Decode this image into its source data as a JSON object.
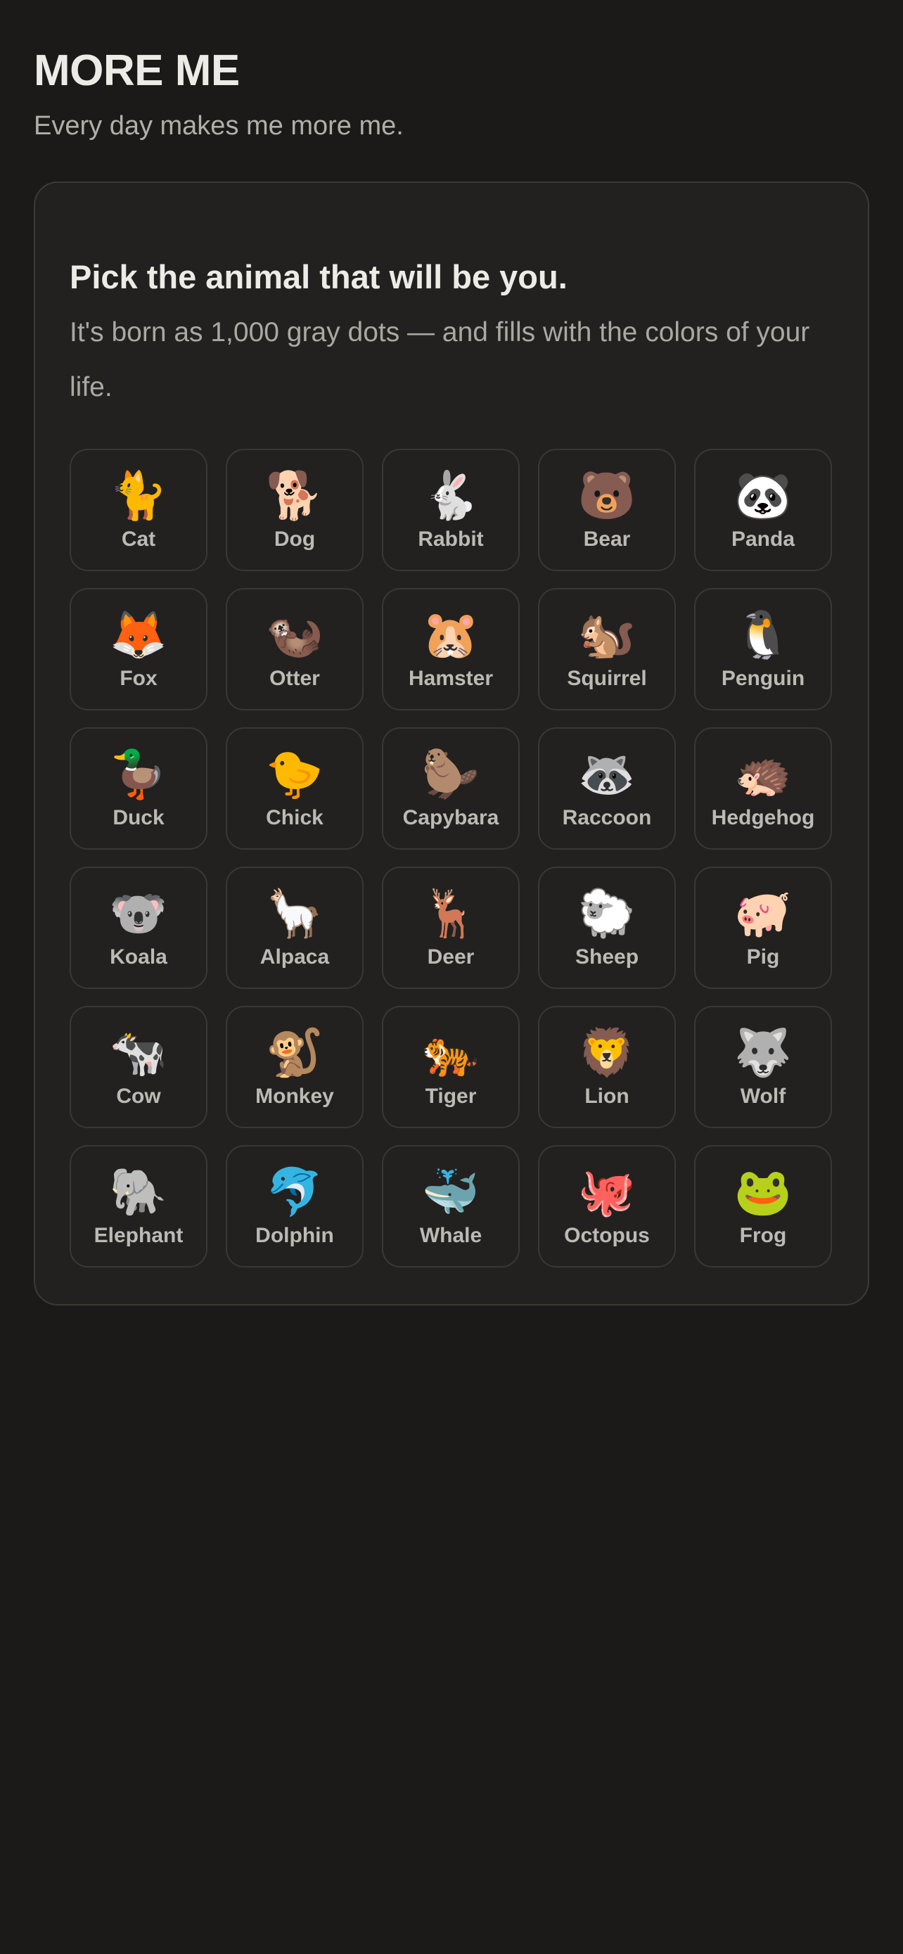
{
  "header": {
    "title": "MORE ME",
    "tagline": "Every day makes me more me."
  },
  "picker": {
    "heading": "Pick the animal that will be you.",
    "description": "It's born as 1,000 gray dots — and fills with the colors of your life.",
    "animals": [
      {
        "label": "Cat",
        "emoji": "🐈",
        "icon": "cat-icon"
      },
      {
        "label": "Dog",
        "emoji": "🐕",
        "icon": "dog-icon"
      },
      {
        "label": "Rabbit",
        "emoji": "🐇",
        "icon": "rabbit-icon"
      },
      {
        "label": "Bear",
        "emoji": "🐻",
        "icon": "bear-icon"
      },
      {
        "label": "Panda",
        "emoji": "🐼",
        "icon": "panda-icon"
      },
      {
        "label": "Fox",
        "emoji": "🦊",
        "icon": "fox-icon"
      },
      {
        "label": "Otter",
        "emoji": "🦦",
        "icon": "otter-icon"
      },
      {
        "label": "Hamster",
        "emoji": "🐹",
        "icon": "hamster-icon"
      },
      {
        "label": "Squirrel",
        "emoji": "🐿️",
        "icon": "squirrel-icon"
      },
      {
        "label": "Penguin",
        "emoji": "🐧",
        "icon": "penguin-icon"
      },
      {
        "label": "Duck",
        "emoji": "🦆",
        "icon": "duck-icon"
      },
      {
        "label": "Chick",
        "emoji": "🐤",
        "icon": "chick-icon"
      },
      {
        "label": "Capybara",
        "emoji": "🦫",
        "icon": "capybara-icon"
      },
      {
        "label": "Raccoon",
        "emoji": "🦝",
        "icon": "raccoon-icon"
      },
      {
        "label": "Hedgehog",
        "emoji": "🦔",
        "icon": "hedgehog-icon"
      },
      {
        "label": "Koala",
        "emoji": "🐨",
        "icon": "koala-icon"
      },
      {
        "label": "Alpaca",
        "emoji": "🦙",
        "icon": "alpaca-icon"
      },
      {
        "label": "Deer",
        "emoji": "🦌",
        "icon": "deer-icon"
      },
      {
        "label": "Sheep",
        "emoji": "🐑",
        "icon": "sheep-icon"
      },
      {
        "label": "Pig",
        "emoji": "🐖",
        "icon": "pig-icon"
      },
      {
        "label": "Cow",
        "emoji": "🐄",
        "icon": "cow-icon"
      },
      {
        "label": "Monkey",
        "emoji": "🐒",
        "icon": "monkey-icon"
      },
      {
        "label": "Tiger",
        "emoji": "🐅",
        "icon": "tiger-icon"
      },
      {
        "label": "Lion",
        "emoji": "🦁",
        "icon": "lion-icon"
      },
      {
        "label": "Wolf",
        "emoji": "🐺",
        "icon": "wolf-icon"
      },
      {
        "label": "Elephant",
        "emoji": "🐘",
        "icon": "elephant-icon"
      },
      {
        "label": "Dolphin",
        "emoji": "🐬",
        "icon": "dolphin-icon"
      },
      {
        "label": "Whale",
        "emoji": "🐳",
        "icon": "whale-icon"
      },
      {
        "label": "Octopus",
        "emoji": "🐙",
        "icon": "octopus-icon"
      },
      {
        "label": "Frog",
        "emoji": "🐸",
        "icon": "frog-icon"
      }
    ]
  },
  "colors": {
    "background": "#1b1a18",
    "card": "#22211f",
    "border": "#3b3a37",
    "title_text": "#ecebe6",
    "muted_text": "#aaa8a1"
  }
}
